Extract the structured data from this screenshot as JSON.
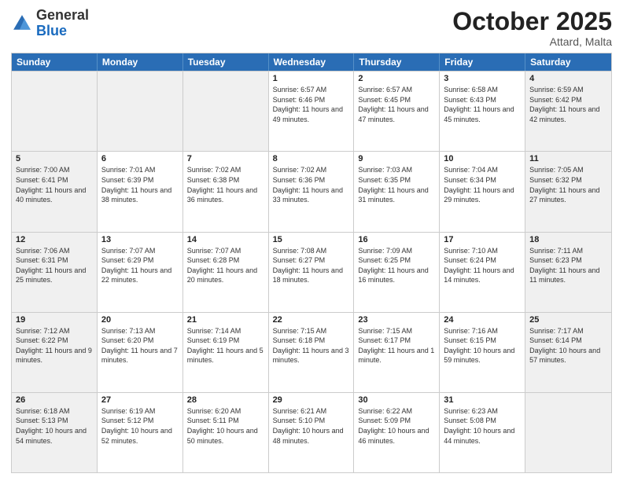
{
  "header": {
    "logo_general": "General",
    "logo_blue": "Blue",
    "month": "October 2025",
    "location": "Attard, Malta"
  },
  "days_of_week": [
    "Sunday",
    "Monday",
    "Tuesday",
    "Wednesday",
    "Thursday",
    "Friday",
    "Saturday"
  ],
  "weeks": [
    [
      {
        "day": "",
        "info": "",
        "shaded": true
      },
      {
        "day": "",
        "info": "",
        "shaded": true
      },
      {
        "day": "",
        "info": "",
        "shaded": true
      },
      {
        "day": "1",
        "info": "Sunrise: 6:57 AM\nSunset: 6:46 PM\nDaylight: 11 hours\nand 49 minutes.",
        "shaded": false
      },
      {
        "day": "2",
        "info": "Sunrise: 6:57 AM\nSunset: 6:45 PM\nDaylight: 11 hours\nand 47 minutes.",
        "shaded": false
      },
      {
        "day": "3",
        "info": "Sunrise: 6:58 AM\nSunset: 6:43 PM\nDaylight: 11 hours\nand 45 minutes.",
        "shaded": false
      },
      {
        "day": "4",
        "info": "Sunrise: 6:59 AM\nSunset: 6:42 PM\nDaylight: 11 hours\nand 42 minutes.",
        "shaded": true
      }
    ],
    [
      {
        "day": "5",
        "info": "Sunrise: 7:00 AM\nSunset: 6:41 PM\nDaylight: 11 hours\nand 40 minutes.",
        "shaded": true
      },
      {
        "day": "6",
        "info": "Sunrise: 7:01 AM\nSunset: 6:39 PM\nDaylight: 11 hours\nand 38 minutes.",
        "shaded": false
      },
      {
        "day": "7",
        "info": "Sunrise: 7:02 AM\nSunset: 6:38 PM\nDaylight: 11 hours\nand 36 minutes.",
        "shaded": false
      },
      {
        "day": "8",
        "info": "Sunrise: 7:02 AM\nSunset: 6:36 PM\nDaylight: 11 hours\nand 33 minutes.",
        "shaded": false
      },
      {
        "day": "9",
        "info": "Sunrise: 7:03 AM\nSunset: 6:35 PM\nDaylight: 11 hours\nand 31 minutes.",
        "shaded": false
      },
      {
        "day": "10",
        "info": "Sunrise: 7:04 AM\nSunset: 6:34 PM\nDaylight: 11 hours\nand 29 minutes.",
        "shaded": false
      },
      {
        "day": "11",
        "info": "Sunrise: 7:05 AM\nSunset: 6:32 PM\nDaylight: 11 hours\nand 27 minutes.",
        "shaded": true
      }
    ],
    [
      {
        "day": "12",
        "info": "Sunrise: 7:06 AM\nSunset: 6:31 PM\nDaylight: 11 hours\nand 25 minutes.",
        "shaded": true
      },
      {
        "day": "13",
        "info": "Sunrise: 7:07 AM\nSunset: 6:29 PM\nDaylight: 11 hours\nand 22 minutes.",
        "shaded": false
      },
      {
        "day": "14",
        "info": "Sunrise: 7:07 AM\nSunset: 6:28 PM\nDaylight: 11 hours\nand 20 minutes.",
        "shaded": false
      },
      {
        "day": "15",
        "info": "Sunrise: 7:08 AM\nSunset: 6:27 PM\nDaylight: 11 hours\nand 18 minutes.",
        "shaded": false
      },
      {
        "day": "16",
        "info": "Sunrise: 7:09 AM\nSunset: 6:25 PM\nDaylight: 11 hours\nand 16 minutes.",
        "shaded": false
      },
      {
        "day": "17",
        "info": "Sunrise: 7:10 AM\nSunset: 6:24 PM\nDaylight: 11 hours\nand 14 minutes.",
        "shaded": false
      },
      {
        "day": "18",
        "info": "Sunrise: 7:11 AM\nSunset: 6:23 PM\nDaylight: 11 hours\nand 11 minutes.",
        "shaded": true
      }
    ],
    [
      {
        "day": "19",
        "info": "Sunrise: 7:12 AM\nSunset: 6:22 PM\nDaylight: 11 hours\nand 9 minutes.",
        "shaded": true
      },
      {
        "day": "20",
        "info": "Sunrise: 7:13 AM\nSunset: 6:20 PM\nDaylight: 11 hours\nand 7 minutes.",
        "shaded": false
      },
      {
        "day": "21",
        "info": "Sunrise: 7:14 AM\nSunset: 6:19 PM\nDaylight: 11 hours\nand 5 minutes.",
        "shaded": false
      },
      {
        "day": "22",
        "info": "Sunrise: 7:15 AM\nSunset: 6:18 PM\nDaylight: 11 hours\nand 3 minutes.",
        "shaded": false
      },
      {
        "day": "23",
        "info": "Sunrise: 7:15 AM\nSunset: 6:17 PM\nDaylight: 11 hours\nand 1 minute.",
        "shaded": false
      },
      {
        "day": "24",
        "info": "Sunrise: 7:16 AM\nSunset: 6:15 PM\nDaylight: 10 hours\nand 59 minutes.",
        "shaded": false
      },
      {
        "day": "25",
        "info": "Sunrise: 7:17 AM\nSunset: 6:14 PM\nDaylight: 10 hours\nand 57 minutes.",
        "shaded": true
      }
    ],
    [
      {
        "day": "26",
        "info": "Sunrise: 6:18 AM\nSunset: 5:13 PM\nDaylight: 10 hours\nand 54 minutes.",
        "shaded": true
      },
      {
        "day": "27",
        "info": "Sunrise: 6:19 AM\nSunset: 5:12 PM\nDaylight: 10 hours\nand 52 minutes.",
        "shaded": false
      },
      {
        "day": "28",
        "info": "Sunrise: 6:20 AM\nSunset: 5:11 PM\nDaylight: 10 hours\nand 50 minutes.",
        "shaded": false
      },
      {
        "day": "29",
        "info": "Sunrise: 6:21 AM\nSunset: 5:10 PM\nDaylight: 10 hours\nand 48 minutes.",
        "shaded": false
      },
      {
        "day": "30",
        "info": "Sunrise: 6:22 AM\nSunset: 5:09 PM\nDaylight: 10 hours\nand 46 minutes.",
        "shaded": false
      },
      {
        "day": "31",
        "info": "Sunrise: 6:23 AM\nSunset: 5:08 PM\nDaylight: 10 hours\nand 44 minutes.",
        "shaded": false
      },
      {
        "day": "",
        "info": "",
        "shaded": true
      }
    ]
  ]
}
